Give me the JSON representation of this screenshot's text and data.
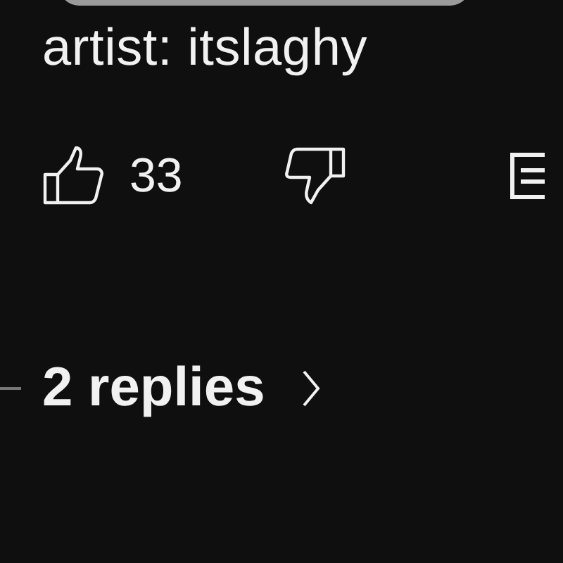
{
  "comment": {
    "text": "artist: itslaghy"
  },
  "actions": {
    "likes": "33",
    "liked": false,
    "disliked": false
  },
  "replies": {
    "label": "2 replies"
  }
}
